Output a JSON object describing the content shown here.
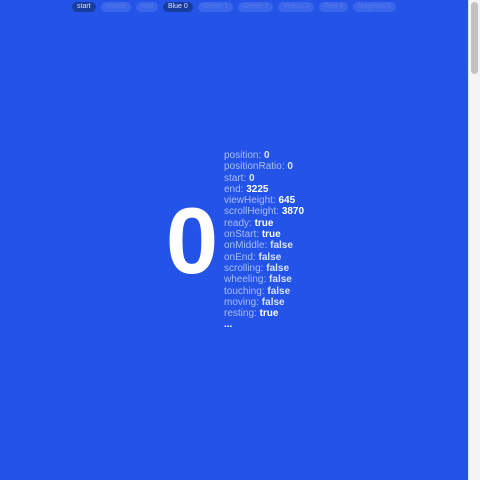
{
  "nav": {
    "items": [
      {
        "label": "start",
        "active": true
      },
      {
        "label": "middle",
        "active": false
      },
      {
        "label": "end",
        "active": false
      },
      {
        "label": "Blue 0",
        "active": true
      },
      {
        "label": "Green 1",
        "active": false
      },
      {
        "label": "Green 2",
        "active": false
      },
      {
        "label": "Yellow 3",
        "active": false
      },
      {
        "label": "Red 4",
        "active": false
      },
      {
        "label": "Magenta 5",
        "active": false
      }
    ]
  },
  "main": {
    "section_number": "0",
    "background_color": "#2453e8"
  },
  "state": [
    {
      "key": "position:",
      "value": "0",
      "dim": true
    },
    {
      "key": "positionRatio:",
      "value": "0",
      "dim": true
    },
    {
      "key": "start:",
      "value": "0",
      "dim": true
    },
    {
      "key": "end:",
      "value": "3225",
      "dim": false
    },
    {
      "key": "viewHeight:",
      "value": "645",
      "dim": false
    },
    {
      "key": "scrollHeight:",
      "value": "3870",
      "dim": false
    },
    {
      "key": "ready:",
      "value": "true",
      "dim": false
    },
    {
      "key": "onStart:",
      "value": "true",
      "dim": false
    },
    {
      "key": "onMiddle:",
      "value": "false",
      "dim": true
    },
    {
      "key": "onEnd:",
      "value": "false",
      "dim": true
    },
    {
      "key": "scrolling:",
      "value": "false",
      "dim": true
    },
    {
      "key": "wheeling:",
      "value": "false",
      "dim": true
    },
    {
      "key": "touching:",
      "value": "false",
      "dim": true
    },
    {
      "key": "moving:",
      "value": "false",
      "dim": true
    },
    {
      "key": "resting:",
      "value": "true",
      "dim": false
    }
  ],
  "state_ellipsis": "..."
}
